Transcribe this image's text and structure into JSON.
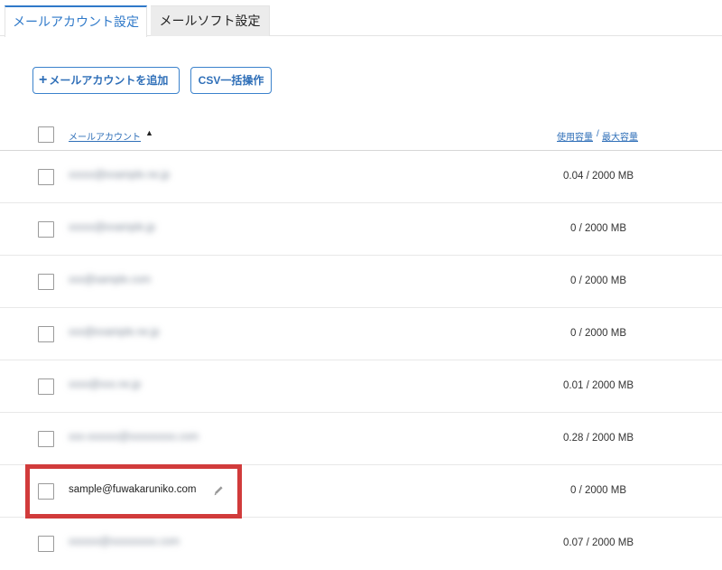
{
  "tabs": [
    {
      "label": "メールアカウント設定",
      "active": true
    },
    {
      "label": "メールソフト設定",
      "active": false
    }
  ],
  "toolbar": {
    "add_icon": "+",
    "add_label": "メールアカウントを追加",
    "csv_label": "CSV一括操作"
  },
  "table": {
    "header": {
      "account_label": "メールアカウント",
      "sort_indicator": "▲",
      "capacity_label": "使用容量",
      "separator": "/",
      "max_label": "最大容量"
    },
    "rows": [
      {
        "email": "xxxxx@example.ne.jp",
        "usage": "0.04 / 2000 MB",
        "blurred": true
      },
      {
        "email": "xxxxx@example.jp",
        "usage": "0 / 2000 MB",
        "blurred": true
      },
      {
        "email": "xxx@sample.com",
        "usage": "0 / 2000 MB",
        "blurred": true
      },
      {
        "email": "xxx@example.ne.jp",
        "usage": "0 / 2000 MB",
        "blurred": true
      },
      {
        "email": "xxxx@xxx.ne.jp",
        "usage": "0.01 / 2000 MB",
        "blurred": true
      },
      {
        "email": "xxx-xxxxxx@xxxxxxxxx.com",
        "usage": "0.28 / 2000 MB",
        "blurred": true
      },
      {
        "email": "sample@fuwakaruniko.com",
        "usage": "0 / 2000 MB",
        "blurred": false
      },
      {
        "email": "xxxxxx@xxxxxxxxx.com",
        "usage": "0.07 / 2000 MB",
        "blurred": true
      }
    ]
  },
  "icons": {
    "edit": "pencil-icon",
    "add": "plus-icon",
    "sort": "sort-ascending-icon"
  },
  "colors": {
    "accent": "#2f79c9",
    "highlight": "#d13b3b"
  }
}
